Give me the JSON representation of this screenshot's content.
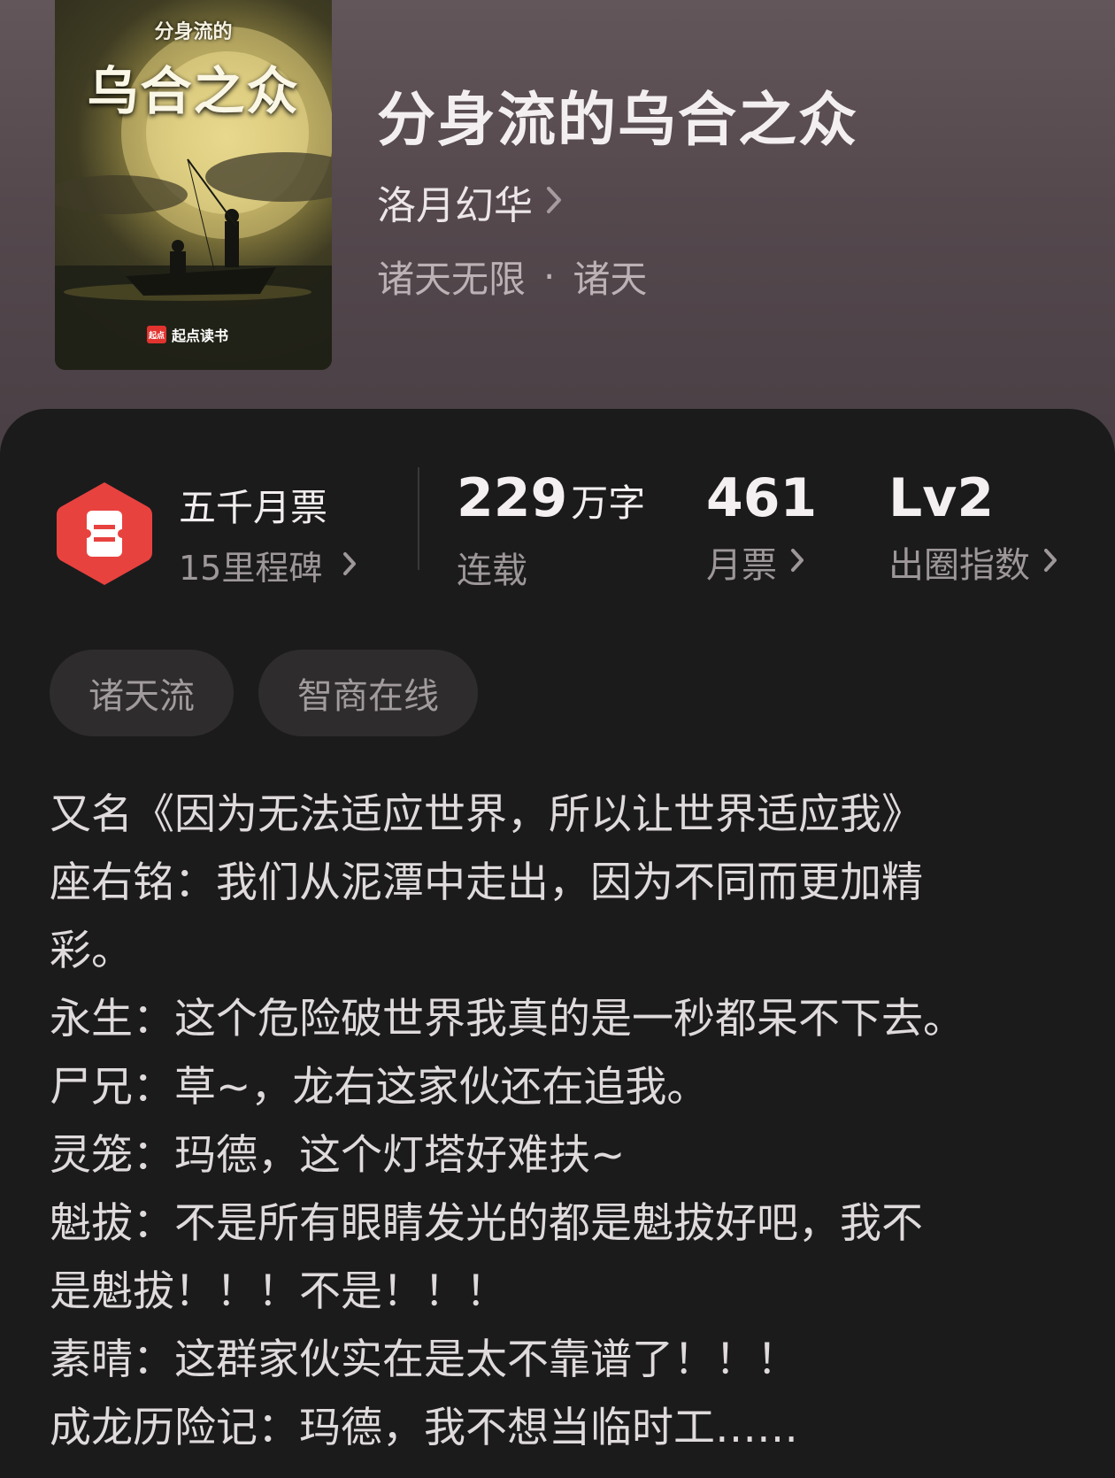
{
  "book": {
    "cover": {
      "small_title": "分身流的",
      "big_title": "乌合之众",
      "brand": "起点读书",
      "brand_logo": "起点"
    },
    "title": "分身流的乌合之众",
    "author": "洛月幻华",
    "genre": "诸天无限",
    "subgenre": "诸天",
    "genre_separator": "·"
  },
  "stats": {
    "milestone_title": "五千月票",
    "milestone_sub": "15里程碑",
    "words_value": "229",
    "words_unit": "万字",
    "words_label": "连载",
    "monthly_votes_value": "461",
    "monthly_votes_label": "月票",
    "influence_value": "Lv2",
    "influence_label": "出圈指数"
  },
  "tags": [
    "诸天流",
    "智商在线"
  ],
  "description": [
    "又名《因为无法适应世界，所以让世界适应我》",
    "座右铭：我们从泥潭中走出，因为不同而更加精",
    "彩。",
    "永生：这个危险破世界我真的是一秒都呆不下去。",
    "尸兄：草~，龙右这家伙还在追我。",
    "灵笼：玛德，这个灯塔好难扶~",
    "魁拔：不是所有眼睛发光的都是魁拔好吧，我不",
    "是魁拔！！！不是！！！",
    "素晴：这群家伙实在是太不靠谱了！！！",
    "成龙历险记：玛德，我不想当临时工……"
  ],
  "colors": {
    "header_bg": "#5a4e53",
    "sheet_bg": "#1c1b1c",
    "badge_red": "#e8423f",
    "tag_bg": "#2e2c2d"
  },
  "icons": {
    "milestone_badge": "ticket-hex-icon",
    "chevron": "chevron-right-icon"
  }
}
